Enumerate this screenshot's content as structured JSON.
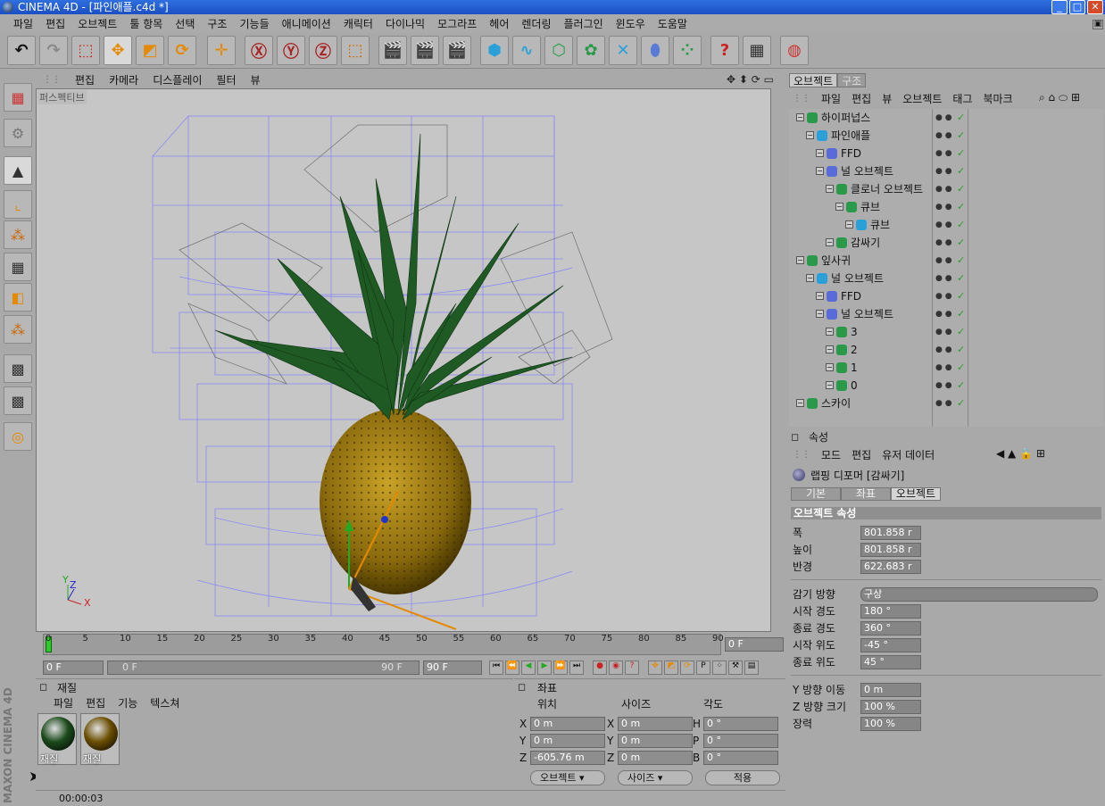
{
  "window": {
    "title": "CINEMA 4D - [파인애플.c4d *]"
  },
  "menu": [
    "파일",
    "편집",
    "오브젝트",
    "툴 항목",
    "선택",
    "구조",
    "기능들",
    "애니메이션",
    "캐릭터",
    "다이나믹",
    "모그라프",
    "헤어",
    "렌더링",
    "플러그인",
    "윈도우",
    "도움말"
  ],
  "viewport": {
    "menu": [
      "편집",
      "카메라",
      "디스플레이",
      "필터",
      "뷰"
    ],
    "label": "퍼스펙티브",
    "axis": {
      "y": "Y",
      "z": "Z",
      "x": "X"
    }
  },
  "timeline": {
    "ticks": [
      "0",
      "5",
      "10",
      "15",
      "20",
      "25",
      "30",
      "35",
      "40",
      "45",
      "50",
      "55",
      "60",
      "65",
      "70",
      "75",
      "80",
      "85",
      "90"
    ],
    "current_frame": "0 F",
    "start_field": "0 F",
    "range_start": "0 F",
    "range_end": "90 F",
    "end_field": "90 F"
  },
  "materials": {
    "title": "재질",
    "menu": [
      "파일",
      "편집",
      "기능",
      "텍스쳐"
    ],
    "items": [
      {
        "name": "재질",
        "color": "#1c4a1c"
      },
      {
        "name": "재질",
        "color": "#6b4e00"
      }
    ]
  },
  "coords": {
    "title": "좌표",
    "headers": [
      "위치",
      "사이즈",
      "각도"
    ],
    "position": [
      {
        "axis": "X",
        "value": "0 m"
      },
      {
        "axis": "Y",
        "value": "0 m"
      },
      {
        "axis": "Z",
        "value": "-605.76 m"
      }
    ],
    "size": [
      {
        "axis": "X",
        "value": "0 m"
      },
      {
        "axis": "Y",
        "value": "0 m"
      },
      {
        "axis": "Z",
        "value": "0 m"
      }
    ],
    "angle": [
      {
        "axis": "H",
        "value": "0 °"
      },
      {
        "axis": "P",
        "value": "0 °"
      },
      {
        "axis": "B",
        "value": "0 °"
      }
    ],
    "mode_select": "오브젝트",
    "size_select": "사이즈",
    "apply_button": "적용"
  },
  "status": {
    "time": "00:00:03",
    "logo": "MAXON CINEMA 4D"
  },
  "object_manager": {
    "tabs": [
      "오브젝트",
      "구조"
    ],
    "menu": [
      "파일",
      "편집",
      "뷰",
      "오브젝트",
      "태그",
      "북마크"
    ],
    "items": [
      {
        "name": "하이퍼넙스",
        "depth": 0
      },
      {
        "name": "파인애플",
        "depth": 1
      },
      {
        "name": "FFD",
        "depth": 2
      },
      {
        "name": "널 오브젝트",
        "depth": 2
      },
      {
        "name": "클로너 오브젝트",
        "depth": 3
      },
      {
        "name": "큐브",
        "depth": 4
      },
      {
        "name": "큐브",
        "depth": 5
      },
      {
        "name": "감싸기",
        "depth": 3
      },
      {
        "name": "잎사귀",
        "depth": 0
      },
      {
        "name": "널 오브젝트",
        "depth": 1
      },
      {
        "name": "FFD",
        "depth": 2
      },
      {
        "name": "널 오브젝트",
        "depth": 2
      },
      {
        "name": "3",
        "depth": 3
      },
      {
        "name": "2",
        "depth": 3
      },
      {
        "name": "1",
        "depth": 3
      },
      {
        "name": "0",
        "depth": 3
      },
      {
        "name": "스카이",
        "depth": 0
      }
    ]
  },
  "attributes": {
    "title": "속성",
    "menu": [
      "모드",
      "편집",
      "유저 데이터"
    ],
    "object_title": "랩핑 디포머 [감싸기]",
    "tabs": [
      "기본",
      "좌표",
      "오브젝트"
    ],
    "section": "오브젝트 속성",
    "props": [
      {
        "label": "폭",
        "value": "801.858 r"
      },
      {
        "label": "높이",
        "value": "801.858 r"
      },
      {
        "label": "반경",
        "value": "622.683 r"
      }
    ],
    "wrap_label": "감기 방향",
    "wrap_value": "구상",
    "angles": [
      {
        "label": "시작 경도",
        "value": "180 °"
      },
      {
        "label": "종료 경도",
        "value": "360 °"
      },
      {
        "label": "시작 위도",
        "value": "-45 °"
      },
      {
        "label": "종료 위도",
        "value": "45 °"
      }
    ],
    "extra": [
      {
        "label": "Y 방향 이동",
        "value": "0 m"
      },
      {
        "label": "Z 방향 크기",
        "value": "100 %"
      },
      {
        "label": "장력",
        "value": "100 %"
      }
    ]
  }
}
